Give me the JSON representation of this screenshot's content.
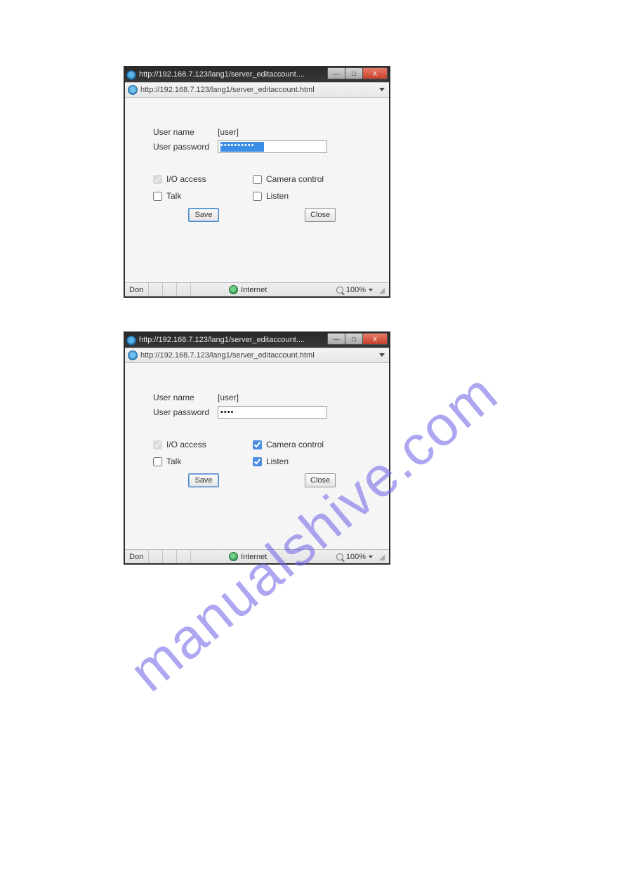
{
  "watermark": "manualshive.com",
  "window1": {
    "title": "http://192.168.7.123/lang1/server_editaccount....",
    "url": "http://192.168.7.123/lang1/server_editaccount.html",
    "user_name_label": "User name",
    "user_name_value": "[user]",
    "user_password_label": "User password",
    "user_password_value": "••••••••••",
    "checks": {
      "io_access_label": "I/O access",
      "io_access_checked": true,
      "camera_label": "Camera control",
      "camera_checked": false,
      "talk_label": "Talk",
      "talk_checked": false,
      "listen_label": "Listen",
      "listen_checked": false
    },
    "buttons": {
      "save": "Save",
      "close": "Close"
    },
    "status": {
      "left": "Don",
      "internet": "Internet",
      "zoom": "100%"
    }
  },
  "window2": {
    "title": "http://192.168.7.123/lang1/server_editaccount....",
    "url": "http://192.168.7.123/lang1/server_editaccount.html",
    "user_name_label": "User name",
    "user_name_value": "[user]",
    "user_password_label": "User password",
    "user_password_value": "••••",
    "checks": {
      "io_access_label": "I/O access",
      "io_access_checked": true,
      "camera_label": "Camera control",
      "camera_checked": true,
      "talk_label": "Talk",
      "talk_checked": false,
      "listen_label": "Listen",
      "listen_checked": true
    },
    "buttons": {
      "save": "Save",
      "close": "Close"
    },
    "status": {
      "left": "Don",
      "internet": "Internet",
      "zoom": "100%"
    }
  }
}
